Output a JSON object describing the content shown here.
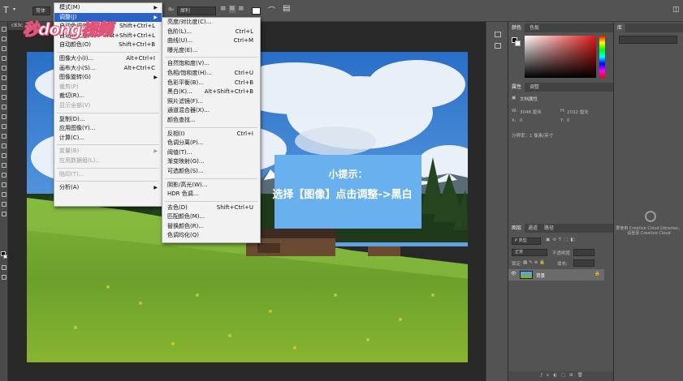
{
  "options_bar": {
    "type_tool": "T",
    "font_style": "常体",
    "font_size": " ",
    "antialias": "犀利"
  },
  "doc_tab": "c83c",
  "image_menu": {
    "items": [
      {
        "label": "模式(M)",
        "shortcut": "",
        "submenu": true,
        "disabled": false
      },
      {
        "label": "调整(J)",
        "shortcut": "",
        "submenu": true,
        "disabled": false,
        "highlight": true
      },
      {
        "label": "自动色调(N)",
        "shortcut": "Shift+Ctrl+L",
        "disabled": false
      },
      {
        "label": "自动对比度(U)",
        "shortcut": "Alt+Shift+Ctrl+L",
        "disabled": false
      },
      {
        "label": "自动颜色(O)",
        "shortcut": "Shift+Ctrl+B",
        "disabled": false
      },
      {
        "sep": true
      },
      {
        "label": "图像大小(I)...",
        "shortcut": "Alt+Ctrl+I",
        "disabled": false
      },
      {
        "label": "画布大小(S)...",
        "shortcut": "Alt+Ctrl+C",
        "disabled": false
      },
      {
        "label": "图像旋转(G)",
        "shortcut": "",
        "submenu": true,
        "disabled": false
      },
      {
        "label": "裁剪(P)",
        "shortcut": "",
        "disabled": true
      },
      {
        "label": "裁切(R)...",
        "shortcut": "",
        "disabled": false
      },
      {
        "label": "显示全部(V)",
        "shortcut": "",
        "disabled": true
      },
      {
        "sep": true
      },
      {
        "label": "复制(D)...",
        "shortcut": "",
        "disabled": false
      },
      {
        "label": "应用图像(Y)...",
        "shortcut": "",
        "disabled": false
      },
      {
        "label": "计算(C)...",
        "shortcut": "",
        "disabled": false
      },
      {
        "sep": true
      },
      {
        "label": "变量(B)",
        "shortcut": "",
        "submenu": true,
        "disabled": true
      },
      {
        "label": "应用数据组(L)...",
        "shortcut": "",
        "disabled": true
      },
      {
        "sep": true
      },
      {
        "label": "陷印(T)...",
        "shortcut": "",
        "disabled": true
      },
      {
        "sep": true
      },
      {
        "label": "分析(A)",
        "shortcut": "",
        "submenu": true,
        "disabled": false
      }
    ]
  },
  "adjust_menu": {
    "items": [
      {
        "label": "亮度/对比度(C)...",
        "shortcut": ""
      },
      {
        "label": "色阶(L)...",
        "shortcut": "Ctrl+L"
      },
      {
        "label": "曲线(U)...",
        "shortcut": "Ctrl+M"
      },
      {
        "label": "曝光度(E)...",
        "shortcut": ""
      },
      {
        "sep": true
      },
      {
        "label": "自然饱和度(V)...",
        "shortcut": ""
      },
      {
        "label": "色相/饱和度(H)...",
        "shortcut": "Ctrl+U"
      },
      {
        "label": "色彩平衡(B)...",
        "shortcut": "Ctrl+B"
      },
      {
        "label": "黑白(K)...",
        "shortcut": "Alt+Shift+Ctrl+B"
      },
      {
        "label": "照片滤镜(F)...",
        "shortcut": ""
      },
      {
        "label": "通道混合器(X)...",
        "shortcut": ""
      },
      {
        "label": "颜色查找...",
        "shortcut": ""
      },
      {
        "sep": true
      },
      {
        "label": "反相(I)",
        "shortcut": "Ctrl+I"
      },
      {
        "label": "色调分离(P)...",
        "shortcut": ""
      },
      {
        "label": "阈值(T)...",
        "shortcut": ""
      },
      {
        "label": "渐变映射(G)...",
        "shortcut": ""
      },
      {
        "label": "可选颜色(S)...",
        "shortcut": ""
      },
      {
        "sep": true
      },
      {
        "label": "阴影/高光(W)...",
        "shortcut": ""
      },
      {
        "label": "HDR 色调...",
        "shortcut": ""
      },
      {
        "sep": true
      },
      {
        "label": "去色(D)",
        "shortcut": "Shift+Ctrl+U"
      },
      {
        "label": "匹配颜色(M)...",
        "shortcut": ""
      },
      {
        "label": "替换颜色(R)...",
        "shortcut": ""
      },
      {
        "label": "色调均化(Q)",
        "shortcut": ""
      }
    ]
  },
  "tip": {
    "title": "小提示：",
    "body": "选择【图像】点击调整->黑白"
  },
  "watermark": "秒dong视频",
  "panels": {
    "color_tabs": [
      "颜色",
      "色板"
    ],
    "props_tabs": [
      "属性",
      "调整"
    ],
    "props_title": "文档属性",
    "width_label": "W:",
    "width_value": "3048 厘米",
    "height_label": "H:",
    "height_value": "2032 厘米",
    "x_label": "X:",
    "x_value": "0",
    "y_label": "Y:",
    "y_value": "0",
    "resolution": "分辨率：1 像素/英寸",
    "layers_tabs": [
      "图层",
      "通道",
      "路径"
    ],
    "layer_kind": "P 类型",
    "blend_mode": "正常",
    "opacity_label": "不透明度:",
    "lock_label": "锁定:",
    "fill_label": "填充:",
    "layer_name": "背景",
    "far_tab": "库",
    "cc_text": "要使用 Creative Cloud Libraries，请登录 Creative Cloud"
  },
  "colors": {
    "highlight": "#2b62c8",
    "tip_bg": "#69b0ee"
  }
}
